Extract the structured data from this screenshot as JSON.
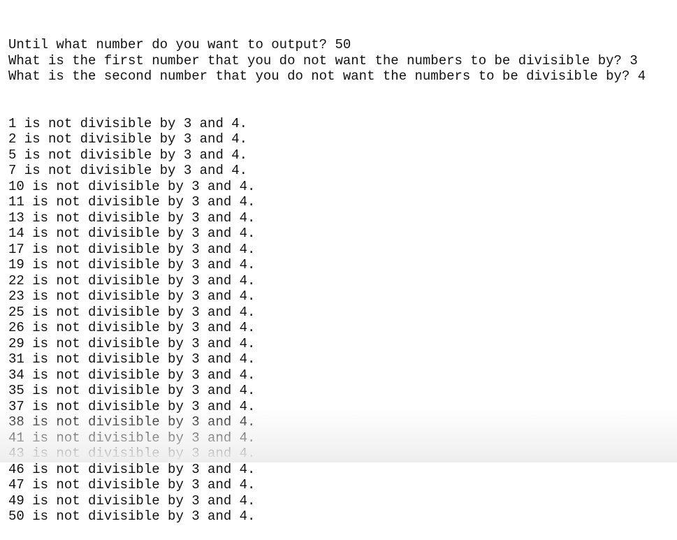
{
  "prompts": [
    "Until what number do you want to output? 50",
    "What is the first number that you do not want the numbers to be divisible by? 3",
    "What is the second number that you do not want the numbers to be divisible by? 4"
  ],
  "results": [
    "1 is not divisible by 3 and 4.",
    "2 is not divisible by 3 and 4.",
    "5 is not divisible by 3 and 4.",
    "7 is not divisible by 3 and 4.",
    "10 is not divisible by 3 and 4.",
    "11 is not divisible by 3 and 4.",
    "13 is not divisible by 3 and 4.",
    "14 is not divisible by 3 and 4.",
    "17 is not divisible by 3 and 4.",
    "19 is not divisible by 3 and 4.",
    "22 is not divisible by 3 and 4.",
    "23 is not divisible by 3 and 4.",
    "25 is not divisible by 3 and 4.",
    "26 is not divisible by 3 and 4.",
    "29 is not divisible by 3 and 4.",
    "31 is not divisible by 3 and 4.",
    "34 is not divisible by 3 and 4.",
    "35 is not divisible by 3 and 4.",
    "37 is not divisible by 3 and 4.",
    "38 is not divisible by 3 and 4.",
    "41 is not divisible by 3 and 4.",
    "43 is not divisible by 3 and 4.",
    "46 is not divisible by 3 and 4.",
    "47 is not divisible by 3 and 4.",
    "49 is not divisible by 3 and 4.",
    "50 is not divisible by 3 and 4."
  ]
}
